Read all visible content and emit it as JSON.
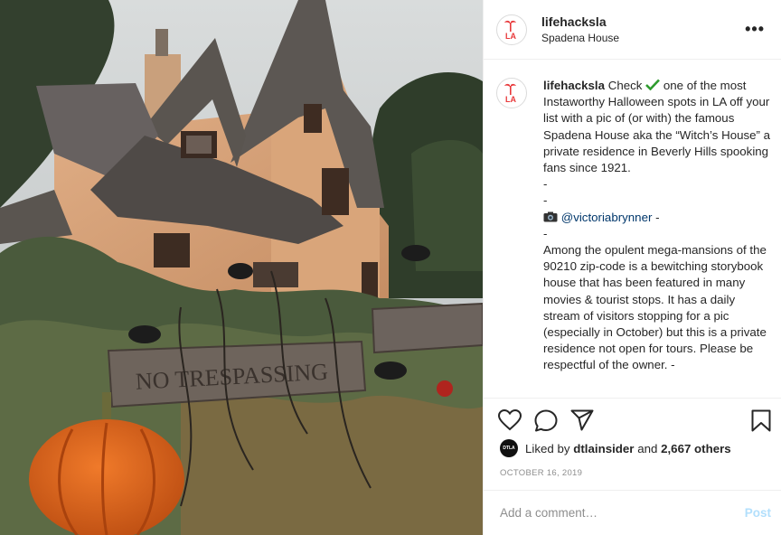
{
  "post": {
    "username": "lifehacksla",
    "location": "Spadena House",
    "avatar_text": "LA",
    "brand_color": "#e8393b"
  },
  "caption": {
    "username": "lifehacksla",
    "intro": "Check",
    "check_icon": "heavy-check-mark",
    "line1_rest": " one of the most Instaworthy Halloween spots in LA off your list with a pic of (or with) the famous Spadena House aka the “Witch’s House” a private residence in Beverly Hills spooking fans since 1921.",
    "dash1": "-",
    "dash2": "-",
    "camera_icon": "camera-emoji",
    "mention": "@victoriabrynner",
    "mention_suffix": " -",
    "dash3": "-",
    "paragraph2": "Among the opulent mega-mansions of the 90210 zip-code is a bewitching storybook house that has been featured in many movies & tourist stops. It has a daily stream of visitors stopping for a pic (especially in October) but this is a private residence not open for tours. Please be respectful of the owner. -"
  },
  "actions": {
    "like_icon": "heart-icon",
    "comment_icon": "comment-icon",
    "share_icon": "share-icon",
    "save_icon": "bookmark-icon"
  },
  "likes": {
    "prefix": "Liked by",
    "user": "dtlainsider",
    "middle": "and",
    "count": "2,667 others",
    "avatar_text": "DTLA"
  },
  "date": "OCTOBER 16, 2019",
  "comment_box": {
    "placeholder": "Add a comment…",
    "post_label": "Post"
  },
  "photo": {
    "sign_text": "NO TRESPASSING"
  }
}
